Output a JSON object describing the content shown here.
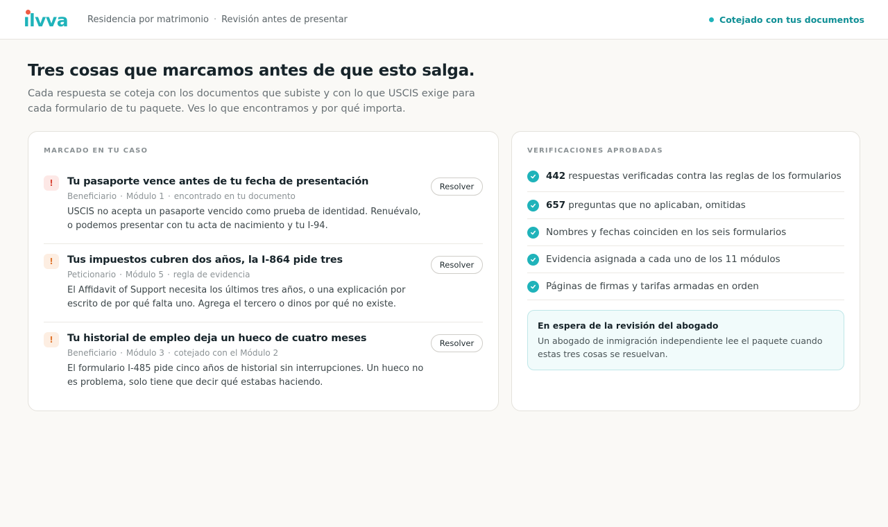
{
  "colors": {
    "accent": "#1fb3ba",
    "accent_text": "#0f8f95",
    "logo_dot": "#ef5b43",
    "flag_red_bg": "#fde8e6",
    "flag_red_fg": "#d9483a",
    "flag_orange_bg": "#fdeee2",
    "flag_orange_fg": "#e0772f",
    "waiting_bg": "#f1fbfb",
    "waiting_border": "#bfe7e8"
  },
  "header": {
    "logo_text": "ılvva",
    "breadcrumbs": [
      "Residencia por matrimonio",
      "Revisión antes de presentar"
    ],
    "breadcrumb_sep": "·",
    "status": "Cotejado con tus documentos"
  },
  "intro": {
    "title": "Tres cosas que marcamos antes de que esto salga.",
    "subtitle": "Cada respuesta se coteja con los documentos que subiste y con lo que USCIS exige para cada formulario de tu paquete. Ves lo que encontramos y por qué importa."
  },
  "flags": {
    "section_label": "Marcado en tu caso",
    "resolve_label": "Resolver",
    "items": [
      {
        "icon": "exclamation-icon",
        "severity": "red",
        "title": "Tu pasaporte vence antes de tu fecha de presentación",
        "meta": [
          "Beneficiario",
          "Módulo 1",
          "encontrado en tu documento"
        ],
        "desc": "USCIS no acepta un pasaporte vencido como prueba de identidad. Renuévalo, o podemos presentar con tu acta de nacimiento y tu I-94."
      },
      {
        "icon": "exclamation-icon",
        "severity": "orange",
        "title": "Tus impuestos cubren dos años, la I-864 pide tres",
        "meta": [
          "Peticionario",
          "Módulo 5",
          "regla de evidencia"
        ],
        "desc": "El Affidavit of Support necesita los últimos tres años, o una explicación por escrito de por qué falta uno. Agrega el tercero o dinos por qué no existe."
      },
      {
        "icon": "exclamation-icon",
        "severity": "orange",
        "title": "Tu historial de empleo deja un hueco de cuatro meses",
        "meta": [
          "Beneficiario",
          "Módulo 3",
          "cotejado con el Módulo 2"
        ],
        "desc": "El formulario I-485 pide cinco años de historial sin interrupciones. Un hueco no es problema, solo tiene que decir qué estabas haciendo."
      }
    ]
  },
  "checks": {
    "section_label": "Verificaciones aprobadas",
    "items": [
      {
        "count": "442",
        "text": "respuestas verificadas contra las reglas de los formularios"
      },
      {
        "count": "657",
        "text": "preguntas que no aplicaban, omitidas"
      },
      {
        "count": "",
        "text": "Nombres y fechas coinciden en los seis formularios"
      },
      {
        "count": "",
        "text": "Evidencia asignada a cada uno de los 11 módulos"
      },
      {
        "count": "",
        "text": "Páginas de firmas y tarifas armadas en orden"
      }
    ],
    "waiting": {
      "title": "En espera de la revisión del abogado",
      "desc": "Un abogado de inmigración independiente lee el paquete cuando estas tres cosas se resuelvan."
    }
  }
}
